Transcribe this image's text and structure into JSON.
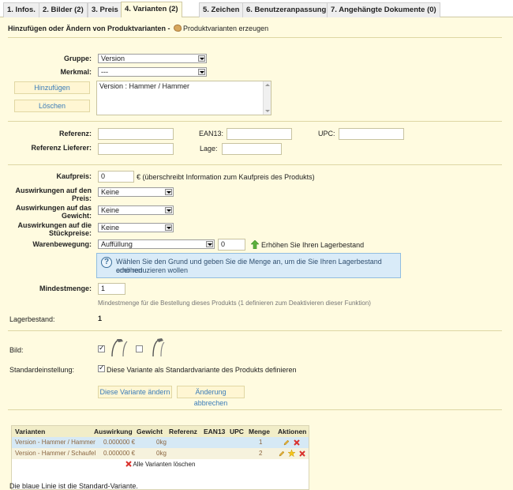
{
  "tabs": [
    {
      "label": "1. Infos."
    },
    {
      "label": "2. Bilder (2)"
    },
    {
      "label": "3. Preis"
    },
    {
      "label": "4. Varianten (2)"
    },
    {
      "label": "5. Zeichen"
    },
    {
      "label": "6. Benutzeranpassung"
    },
    {
      "label": "7. Angehängte Dokumente (0)"
    }
  ],
  "heading": {
    "text": "Hinzufügen oder Ändern von Produktvarianten - ",
    "link": "Produktvarianten erzeugen"
  },
  "group": {
    "gruppe_label": "Gruppe:",
    "gruppe_value": "Version",
    "merkmal_label": "Merkmal:",
    "merkmal_value": "---",
    "add_button": "Hinzufügen",
    "delete_button": "Löschen",
    "list_item": "Version : Hammer / Hammer"
  },
  "refs": {
    "referenz_label": "Referenz:",
    "ean13_label": "EAN13:",
    "upc_label": "UPC:",
    "lieferer_label": "Referenz Lieferer:",
    "lage_label": "Lage:"
  },
  "price": {
    "kaufpreis_label": "Kaufpreis:",
    "kaufpreis_value": "0",
    "kaufpreis_note": "€ (überschreibt Information zum Kaufpreis des Produkts)",
    "preis_label_1": "Auswirkungen auf den",
    "preis_label_2": "Preis:",
    "preis_value": "Keine",
    "gewicht_label_1": "Auswirkungen auf das",
    "gewicht_label_2": "Gewicht:",
    "gewicht_value": "Keine",
    "stueck_label_1": "Auswirkungen auf die",
    "stueck_label_2": "Stückpreise:",
    "stueck_value": "Keine",
    "waren_label": "Warenbewegung:",
    "waren_value": "Auffüllung",
    "waren_qty": "0",
    "lager_link": "Erhöhen Sie Ihren Lagerbestand",
    "info_line1": "Wählen Sie den Grund und geben Sie die Menge an, um die Sie Ihren Lagerbestand erhöhen",
    "info_line2": "oder reduzieren wollen",
    "mindest_label": "Mindestmenge:",
    "mindest_value": "1",
    "mindest_hint": "Mindestmenge für die Bestellung dieses Produkts (1 definieren zum Deaktivieren dieser Funktion)",
    "lager_label": "Lagerbestand:",
    "lager_value": "1"
  },
  "image": {
    "bild_label": "Bild:",
    "standard_label": "Standardeinstellung:",
    "standard_text": "Diese Variante als Standardvariante des Produkts definieren",
    "save_button": "Diese Variante ändern",
    "cancel_button": "Änderung abbrechen"
  },
  "table": {
    "headers": [
      "Varianten",
      "Auswirkung",
      "Gewicht",
      "Referenz",
      "EAN13",
      "UPC",
      "Menge",
      "Aktionen"
    ],
    "rows": [
      {
        "variant": "Version - Hammer / Hammer",
        "impact": "0.000000 €",
        "weight": "0kg",
        "qty": "1"
      },
      {
        "variant": "Version - Hammer / Schaufel",
        "impact": "0.000000 €",
        "weight": "0kg",
        "qty": "2"
      }
    ],
    "delete_all": "Alle Varianten löschen"
  },
  "footer": {
    "note": "Die blaue Linie ist die Standard-Variante."
  },
  "colors": {
    "panel_bg": "#fffbe0",
    "default_row": "#d6e9f5",
    "link": "#3a7cb8",
    "delete_red": "#d9302b"
  }
}
